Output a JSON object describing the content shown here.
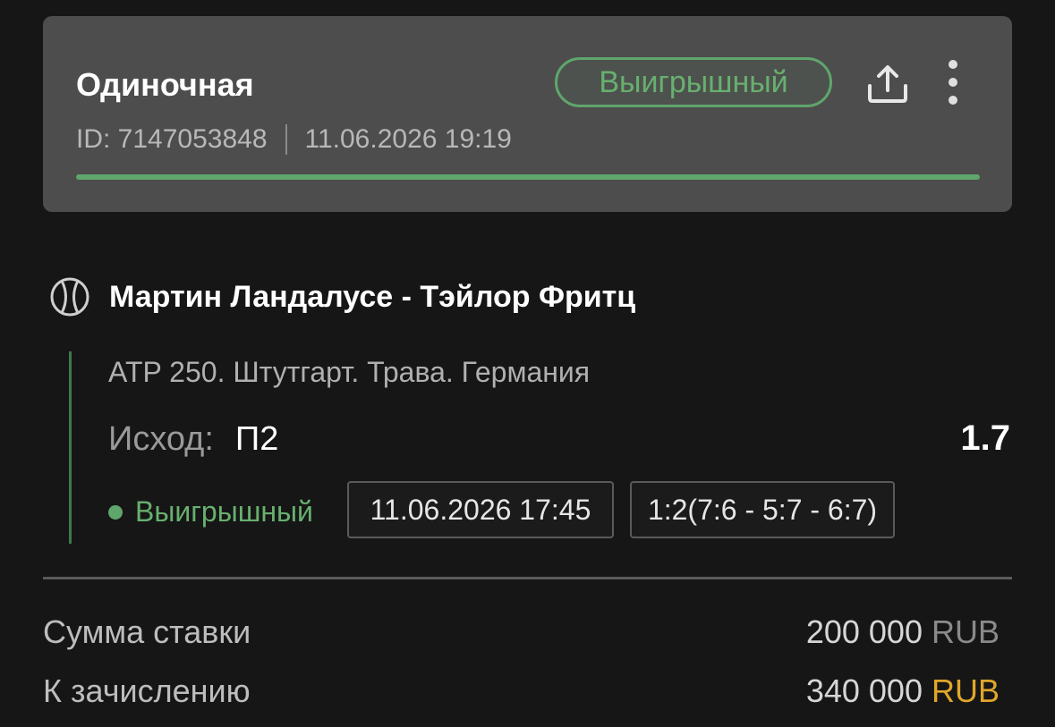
{
  "header": {
    "bet_type": "Одиночная",
    "status": "Выигрышный",
    "id_text": "ID: 7147053848",
    "datetime": "11.06.2026 19:19",
    "progress": 1.0,
    "share_icon": "share-icon",
    "more_icon": "more-vertical-icon"
  },
  "event": {
    "sport_icon": "tennis-ball-icon",
    "name": "Мартин Ландалусе - Тэйлор Фритц",
    "tournament": "ATP 250. Штутгарт. Трава. Германия",
    "outcome_label": "Исход:",
    "outcome_value": "П2",
    "odds": "1.7",
    "status": "Выигрышный",
    "start_time": "11.06.2026 17:45",
    "score": "1:2(7:6 - 5:7 - 6:7)"
  },
  "summary": {
    "stake_label": "Сумма ставки",
    "stake_amount": "200 000",
    "stake_currency": "RUB",
    "payout_label": "К зачислению",
    "payout_amount": "340 000",
    "payout_currency": "RUB"
  },
  "colors": {
    "accent_green": "#5fa66c",
    "currency_gold": "#e0a62a",
    "card_bg": "#4d4d4d",
    "page_bg": "#161616"
  }
}
